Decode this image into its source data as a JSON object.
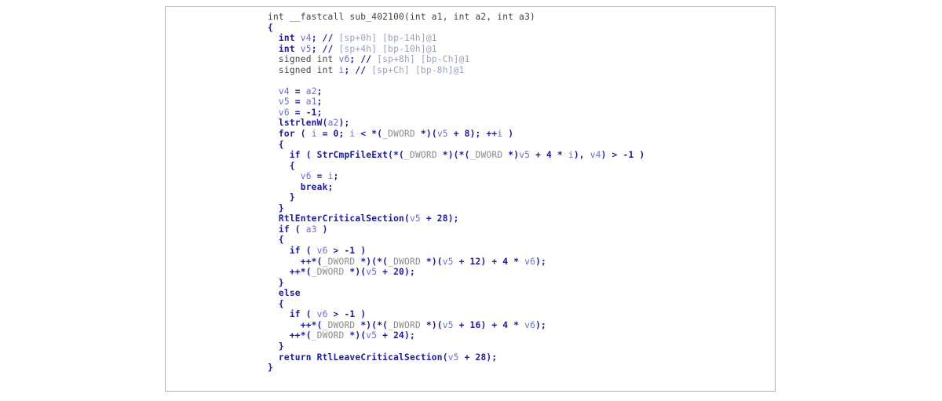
{
  "window": {
    "title": "Decompiled pseudocode listing",
    "background_color": "#ffffff",
    "frame_border_color": "#b3b3b3"
  },
  "palette": {
    "plain": "#444444",
    "keyword": "#1a1aa6",
    "variable": "#6a6ad6",
    "type": "#8a8a8a",
    "comment": "#9aa0c0"
  },
  "code": {
    "language": "c-pseudocode",
    "function_name": "sub_402100",
    "lines": [
      {
        "id": "l1",
        "indent": 0,
        "tokens": [
          {
            "t": "int __fastcall sub_402100(int a1, int a2, int a3)",
            "c": "plain"
          }
        ]
      },
      {
        "id": "l2",
        "indent": 0,
        "tokens": [
          {
            "t": "{",
            "c": "kw"
          }
        ]
      },
      {
        "id": "l3",
        "indent": 1,
        "tokens": [
          {
            "t": "int ",
            "c": "kw"
          },
          {
            "t": "v4",
            "c": "var"
          },
          {
            "t": "; ",
            "c": "kw"
          },
          {
            "t": "// ",
            "c": "kw"
          },
          {
            "t": "[sp+0h] [bp-14h]@1",
            "c": "cmt"
          }
        ]
      },
      {
        "id": "l4",
        "indent": 1,
        "tokens": [
          {
            "t": "int ",
            "c": "kw"
          },
          {
            "t": "v5",
            "c": "var"
          },
          {
            "t": "; ",
            "c": "kw"
          },
          {
            "t": "// ",
            "c": "kw"
          },
          {
            "t": "[sp+4h] [bp-10h]@1",
            "c": "cmt"
          }
        ]
      },
      {
        "id": "l5",
        "indent": 1,
        "tokens": [
          {
            "t": "signed int ",
            "c": "decl"
          },
          {
            "t": "v6",
            "c": "var"
          },
          {
            "t": "; ",
            "c": "kw"
          },
          {
            "t": "// ",
            "c": "kw"
          },
          {
            "t": "[sp+8h] [bp-Ch]@1",
            "c": "cmt"
          }
        ]
      },
      {
        "id": "l6",
        "indent": 1,
        "tokens": [
          {
            "t": "signed int ",
            "c": "decl"
          },
          {
            "t": "i",
            "c": "var"
          },
          {
            "t": "; ",
            "c": "kw"
          },
          {
            "t": "// ",
            "c": "kw"
          },
          {
            "t": "[sp+Ch] [bp-8h]@1",
            "c": "cmt"
          }
        ]
      },
      {
        "id": "l7",
        "indent": 0,
        "tokens": [
          {
            "t": "",
            "c": "plain"
          }
        ]
      },
      {
        "id": "l8",
        "indent": 1,
        "tokens": [
          {
            "t": "v4",
            "c": "var"
          },
          {
            "t": " = ",
            "c": "kw"
          },
          {
            "t": "a2",
            "c": "var"
          },
          {
            "t": ";",
            "c": "kw"
          }
        ]
      },
      {
        "id": "l9",
        "indent": 1,
        "tokens": [
          {
            "t": "v5",
            "c": "var"
          },
          {
            "t": " = ",
            "c": "kw"
          },
          {
            "t": "a1",
            "c": "var"
          },
          {
            "t": ";",
            "c": "kw"
          }
        ]
      },
      {
        "id": "l10",
        "indent": 1,
        "tokens": [
          {
            "t": "v6",
            "c": "var"
          },
          {
            "t": " = -1;",
            "c": "kw"
          }
        ]
      },
      {
        "id": "l11",
        "indent": 1,
        "tokens": [
          {
            "t": "lstrlenW",
            "c": "kw"
          },
          {
            "t": "(",
            "c": "kw"
          },
          {
            "t": "a2",
            "c": "var"
          },
          {
            "t": ");",
            "c": "kw"
          }
        ]
      },
      {
        "id": "l12",
        "indent": 1,
        "tokens": [
          {
            "t": "for ( ",
            "c": "kw"
          },
          {
            "t": "i",
            "c": "var"
          },
          {
            "t": " = 0; ",
            "c": "kw"
          },
          {
            "t": "i",
            "c": "var"
          },
          {
            "t": " < *(",
            "c": "kw"
          },
          {
            "t": "_DWORD",
            "c": "type"
          },
          {
            "t": " *)(",
            "c": "kw"
          },
          {
            "t": "v5",
            "c": "var"
          },
          {
            "t": " + 8); ++",
            "c": "kw"
          },
          {
            "t": "i",
            "c": "var"
          },
          {
            "t": " )",
            "c": "kw"
          }
        ]
      },
      {
        "id": "l13",
        "indent": 1,
        "tokens": [
          {
            "t": "{",
            "c": "kw"
          }
        ]
      },
      {
        "id": "l14",
        "indent": 2,
        "tokens": [
          {
            "t": "if ( ",
            "c": "kw"
          },
          {
            "t": "StrCmpFileExt",
            "c": "kw"
          },
          {
            "t": "(*(",
            "c": "kw"
          },
          {
            "t": "_DWORD",
            "c": "type"
          },
          {
            "t": " *)(*(",
            "c": "kw"
          },
          {
            "t": "_DWORD",
            "c": "type"
          },
          {
            "t": " *)",
            "c": "kw"
          },
          {
            "t": "v5",
            "c": "var"
          },
          {
            "t": " + 4 * ",
            "c": "kw"
          },
          {
            "t": "i",
            "c": "var"
          },
          {
            "t": "), ",
            "c": "kw"
          },
          {
            "t": "v4",
            "c": "var"
          },
          {
            "t": ") > -1 )",
            "c": "kw"
          }
        ]
      },
      {
        "id": "l15",
        "indent": 2,
        "tokens": [
          {
            "t": "{",
            "c": "kw"
          }
        ]
      },
      {
        "id": "l16",
        "indent": 3,
        "tokens": [
          {
            "t": "v6",
            "c": "var"
          },
          {
            "t": " = ",
            "c": "kw"
          },
          {
            "t": "i",
            "c": "var"
          },
          {
            "t": ";",
            "c": "kw"
          }
        ]
      },
      {
        "id": "l17",
        "indent": 3,
        "tokens": [
          {
            "t": "break;",
            "c": "kw"
          }
        ]
      },
      {
        "id": "l18",
        "indent": 2,
        "tokens": [
          {
            "t": "}",
            "c": "kw"
          }
        ]
      },
      {
        "id": "l19",
        "indent": 1,
        "tokens": [
          {
            "t": "}",
            "c": "kw"
          }
        ]
      },
      {
        "id": "l20",
        "indent": 1,
        "tokens": [
          {
            "t": "RtlEnterCriticalSection",
            "c": "kw"
          },
          {
            "t": "(",
            "c": "kw"
          },
          {
            "t": "v5",
            "c": "var"
          },
          {
            "t": " + 28);",
            "c": "kw"
          }
        ]
      },
      {
        "id": "l21",
        "indent": 1,
        "tokens": [
          {
            "t": "if ( ",
            "c": "kw"
          },
          {
            "t": "a3",
            "c": "var"
          },
          {
            "t": " )",
            "c": "kw"
          }
        ]
      },
      {
        "id": "l22",
        "indent": 1,
        "tokens": [
          {
            "t": "{",
            "c": "kw"
          }
        ]
      },
      {
        "id": "l23",
        "indent": 2,
        "tokens": [
          {
            "t": "if ( ",
            "c": "kw"
          },
          {
            "t": "v6",
            "c": "var"
          },
          {
            "t": " > -1 )",
            "c": "kw"
          }
        ]
      },
      {
        "id": "l24",
        "indent": 3,
        "tokens": [
          {
            "t": "++*(",
            "c": "kw"
          },
          {
            "t": "_DWORD",
            "c": "type"
          },
          {
            "t": " *)(*(",
            "c": "kw"
          },
          {
            "t": "_DWORD",
            "c": "type"
          },
          {
            "t": " *)(",
            "c": "kw"
          },
          {
            "t": "v5",
            "c": "var"
          },
          {
            "t": " + 12) + 4 * ",
            "c": "kw"
          },
          {
            "t": "v6",
            "c": "var"
          },
          {
            "t": ");",
            "c": "kw"
          }
        ]
      },
      {
        "id": "l25",
        "indent": 2,
        "tokens": [
          {
            "t": "++*(",
            "c": "kw"
          },
          {
            "t": "_DWORD",
            "c": "type"
          },
          {
            "t": " *)(",
            "c": "kw"
          },
          {
            "t": "v5",
            "c": "var"
          },
          {
            "t": " + 20);",
            "c": "kw"
          }
        ]
      },
      {
        "id": "l26",
        "indent": 1,
        "tokens": [
          {
            "t": "}",
            "c": "kw"
          }
        ]
      },
      {
        "id": "l27",
        "indent": 1,
        "tokens": [
          {
            "t": "else",
            "c": "kw"
          }
        ]
      },
      {
        "id": "l28",
        "indent": 1,
        "tokens": [
          {
            "t": "{",
            "c": "kw"
          }
        ]
      },
      {
        "id": "l29",
        "indent": 2,
        "tokens": [
          {
            "t": "if ( ",
            "c": "kw"
          },
          {
            "t": "v6",
            "c": "var"
          },
          {
            "t": " > -1 )",
            "c": "kw"
          }
        ]
      },
      {
        "id": "l30",
        "indent": 3,
        "tokens": [
          {
            "t": "++*(",
            "c": "kw"
          },
          {
            "t": "_DWORD",
            "c": "type"
          },
          {
            "t": " *)(*(",
            "c": "kw"
          },
          {
            "t": "_DWORD",
            "c": "type"
          },
          {
            "t": " *)(",
            "c": "kw"
          },
          {
            "t": "v5",
            "c": "var"
          },
          {
            "t": " + 16) + 4 * ",
            "c": "kw"
          },
          {
            "t": "v6",
            "c": "var"
          },
          {
            "t": ");",
            "c": "kw"
          }
        ]
      },
      {
        "id": "l31",
        "indent": 2,
        "tokens": [
          {
            "t": "++*(",
            "c": "kw"
          },
          {
            "t": "_DWORD",
            "c": "type"
          },
          {
            "t": " *)(",
            "c": "kw"
          },
          {
            "t": "v5",
            "c": "var"
          },
          {
            "t": " + 24);",
            "c": "kw"
          }
        ]
      },
      {
        "id": "l32",
        "indent": 1,
        "tokens": [
          {
            "t": "}",
            "c": "kw"
          }
        ]
      },
      {
        "id": "l33",
        "indent": 1,
        "tokens": [
          {
            "t": "return ",
            "c": "kw"
          },
          {
            "t": "RtlLeaveCriticalSection",
            "c": "kw"
          },
          {
            "t": "(",
            "c": "kw"
          },
          {
            "t": "v5",
            "c": "var"
          },
          {
            "t": " + 28);",
            "c": "kw"
          }
        ]
      },
      {
        "id": "l34",
        "indent": 0,
        "tokens": [
          {
            "t": "}",
            "c": "kw"
          }
        ]
      }
    ]
  }
}
